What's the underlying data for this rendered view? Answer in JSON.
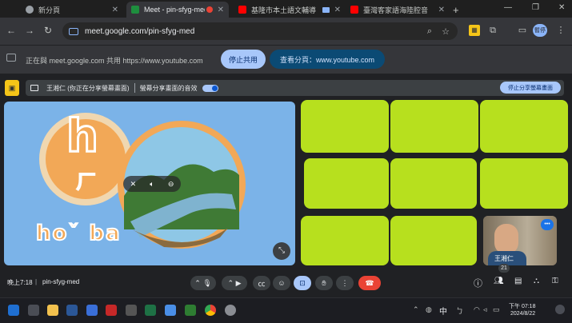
{
  "browser": {
    "tabs": [
      {
        "title": "新分頁",
        "fav_color": "#9aa0a6",
        "active": false
      },
      {
        "title": "Meet - pin-sfyg-med",
        "fav_color": "#1e8e3e",
        "active": true
      },
      {
        "title": "基隆市本土語文輔導",
        "fav_color": "#ff0000",
        "active": false
      },
      {
        "title": "臺灣客家語海陸腔音",
        "fav_color": "#ff0000",
        "active": false
      }
    ],
    "new_tab": "+",
    "url": "meet.google.com/pin-sfyg-med",
    "profile_label": "暫停"
  },
  "sharebar": {
    "text": "正在與 meet.google.com 共用 https://www.youtube.com",
    "stop_label": "停止共用",
    "view_label": "查看分頁：www.youtube.com"
  },
  "presenting": {
    "text": "王湘仁 (你正在分享螢幕畫面)",
    "audio_text": "螢幕分享畫面的音效",
    "stop_label": "停止分享螢幕畫面"
  },
  "slide": {
    "letter": "h",
    "bopomofo": "ㄏ",
    "syllables": "hoˇ ba"
  },
  "selfview": {
    "name": "王湘仁",
    "more": "•••"
  },
  "bottom": {
    "time": "晚上7:18",
    "separator": "|",
    "meeting_code": "pin-sfyg-med",
    "participant_count": "21"
  },
  "taskbar": {
    "ime": "中",
    "time": "下午 07:18",
    "date": "2024/8/22"
  },
  "colors": {
    "tile": "#b7e01e",
    "accent_blue": "#a8c7fa",
    "end_call": "#ea4335"
  }
}
